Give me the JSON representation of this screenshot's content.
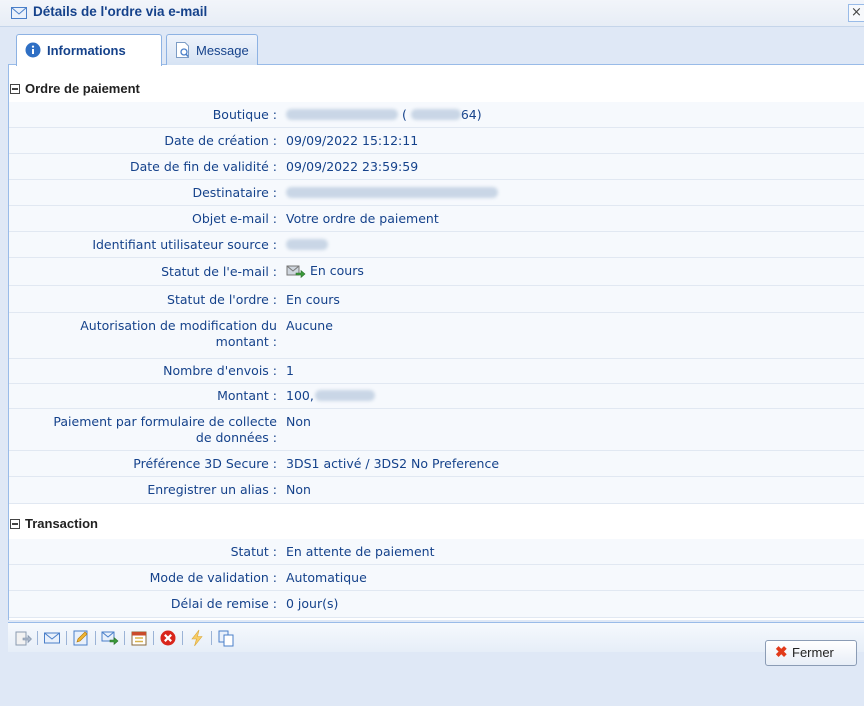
{
  "window": {
    "title": "Détails de l'ordre via e-mail",
    "close_glyph": "×"
  },
  "tabs": [
    {
      "label": "Informations",
      "icon": "info-icon",
      "active": true
    },
    {
      "label": "Message",
      "icon": "document-icon",
      "active": false
    }
  ],
  "sections": {
    "order": {
      "title": "Ordre de paiement",
      "rows": {
        "boutique": {
          "label": "Boutique :",
          "open": "(",
          "suffix": "64)"
        },
        "date_creation": {
          "label": "Date de création :",
          "value": "09/09/2022 15:12:11"
        },
        "date_fin": {
          "label": "Date de fin de validité :",
          "value": "09/09/2022 23:59:59"
        },
        "destinataire": {
          "label": "Destinataire :"
        },
        "objet": {
          "label": "Objet e-mail :",
          "value": "Votre ordre de paiement"
        },
        "identifiant": {
          "label": "Identifiant utilisateur source :"
        },
        "statut_email": {
          "label": "Statut de l'e-mail :",
          "value": "En cours",
          "icon": "email-sending-icon"
        },
        "statut_ordre": {
          "label": "Statut de l'ordre :",
          "value": "En cours"
        },
        "autorisation": {
          "label_line1": "Autorisation de modification du",
          "label_line2": "montant :",
          "value": "Aucune"
        },
        "nombre_envois": {
          "label": "Nombre d'envois :",
          "value": "1"
        },
        "montant": {
          "label": "Montant :",
          "value": "100,"
        },
        "formulaire": {
          "label_line1": "Paiement par formulaire de collecte",
          "label_line2": "de données :",
          "value": "Non"
        },
        "pref3ds": {
          "label": "Préférence 3D Secure :",
          "value": "3DS1 activé / 3DS2 No Preference"
        },
        "alias": {
          "label": "Enregistrer un alias :",
          "value": "Non"
        }
      }
    },
    "transaction": {
      "title": "Transaction",
      "rows": {
        "statut": {
          "label": "Statut :",
          "value": "En attente de paiement"
        },
        "mode": {
          "label": "Mode de validation :",
          "value": "Automatique"
        },
        "delai": {
          "label": "Délai de remise :",
          "value": "0 jour(s)"
        }
      }
    }
  },
  "toolbar": {
    "buttons": [
      "export-icon",
      "email-icon",
      "edit-icon",
      "resend-email-icon",
      "calendar-icon",
      "cancel-icon",
      "lightning-icon",
      "duplicate-icon"
    ]
  },
  "footer": {
    "close_label": "Fermer"
  },
  "colors": {
    "label_text": "#15428b",
    "window_bg": "#dfe8f6",
    "row_bg": "#f6f9fd",
    "border": "#99bbe8"
  }
}
